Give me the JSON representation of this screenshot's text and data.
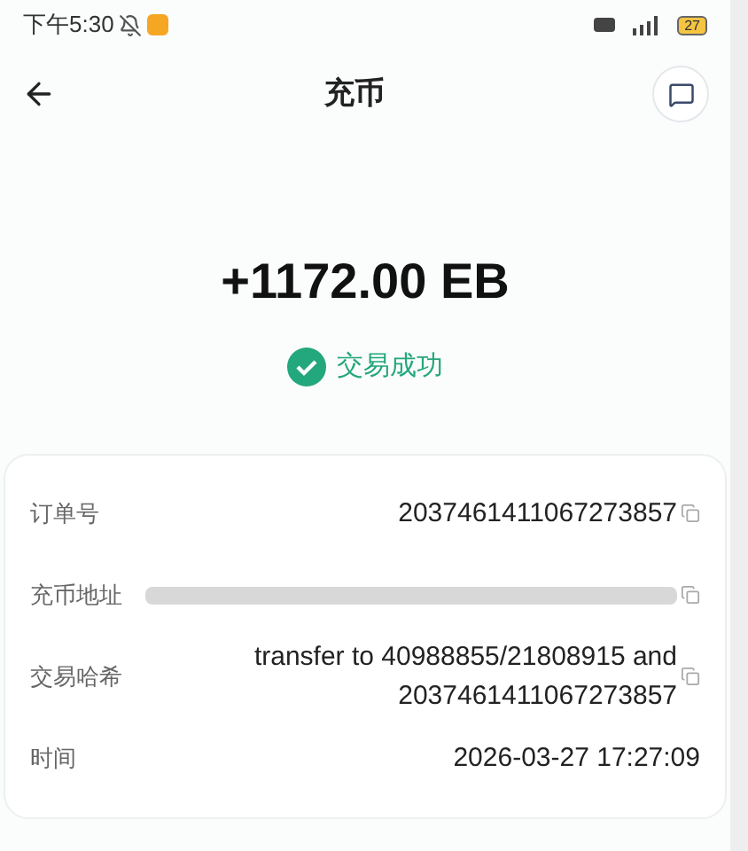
{
  "status_bar": {
    "time": "下午5:30",
    "battery": "27"
  },
  "nav": {
    "title": "充币"
  },
  "amount": "+1172.00 EB",
  "result": {
    "text": "交易成功"
  },
  "details": [
    {
      "kind": "text",
      "label": "订单号",
      "value": "2037461411067273857"
    },
    {
      "kind": "redacted",
      "label": "充币地址"
    },
    {
      "kind": "text",
      "label": "交易哈希",
      "value": "transfer to 40988855/21808915 and 2037461411067273857"
    },
    {
      "kind": "plain",
      "label": "时间",
      "value": "2026-03-27 17:27:09"
    }
  ]
}
